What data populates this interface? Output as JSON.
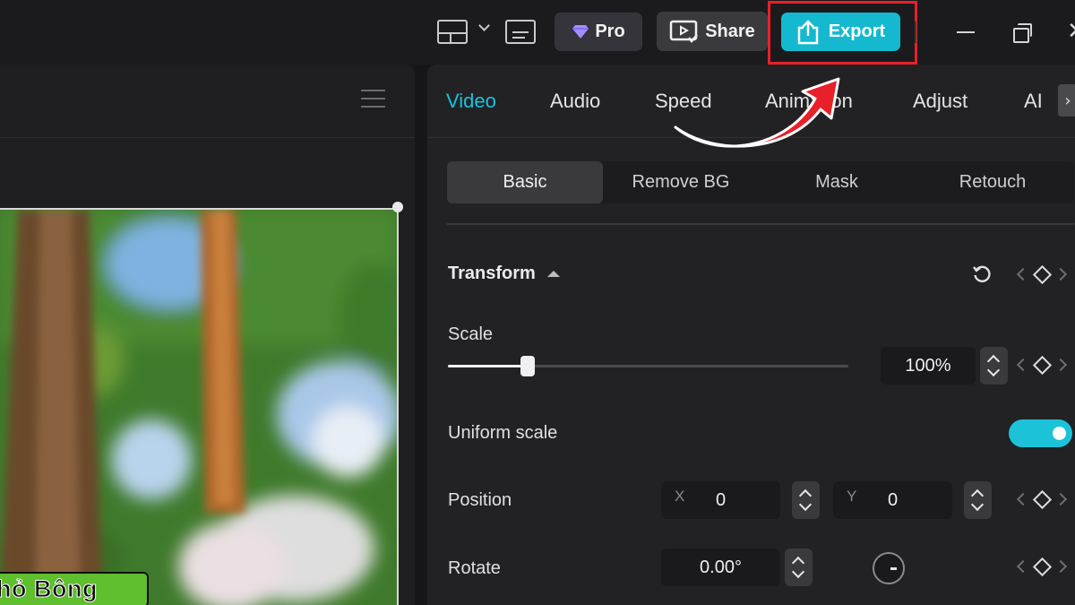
{
  "toolbar": {
    "layout_icon": "layout-icon",
    "caption_icon": "caption-icon",
    "pro_label": "Pro",
    "share_label": "Share",
    "export_label": "Export",
    "export_color": "#14b9cf",
    "highlight_color": "#e8202a"
  },
  "player": {
    "caption_text": "hỏ Bông"
  },
  "inspector": {
    "tabs": [
      "Video",
      "Audio",
      "Speed",
      "Animation",
      "Adjust",
      "AI"
    ],
    "subtabs": [
      "Basic",
      "Remove BG",
      "Mask",
      "Retouch"
    ],
    "transform": {
      "title": "Transform",
      "scale_label": "Scale",
      "scale_value": "100%",
      "scale_level": 0.2,
      "uniform_scale_label": "Uniform scale",
      "uniform_scale_on": true,
      "position_label": "Position",
      "x_label": "X",
      "x_value": "0",
      "y_label": "Y",
      "y_value": "0",
      "rotate_label": "Rotate",
      "rotate_value": "0.00°"
    },
    "accent": "#1cc3d8"
  }
}
